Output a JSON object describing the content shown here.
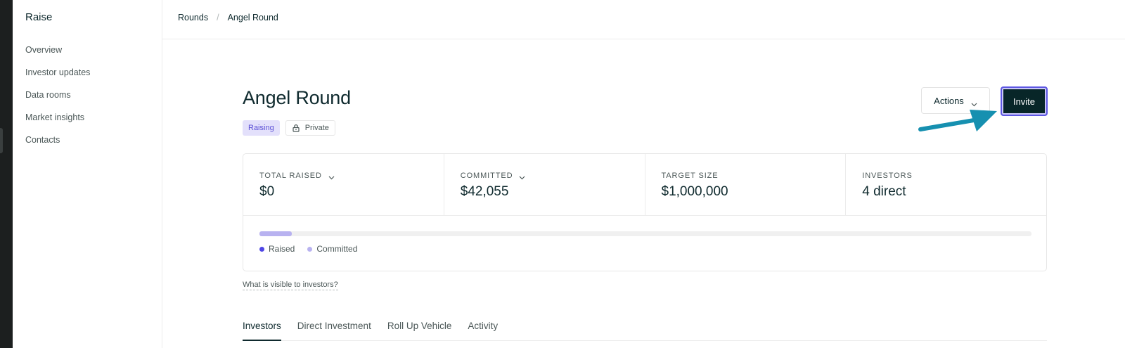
{
  "sidebar": {
    "brand": "Raise",
    "items": [
      {
        "label": "Overview"
      },
      {
        "label": "Investor updates"
      },
      {
        "label": "Data rooms"
      },
      {
        "label": "Market insights"
      },
      {
        "label": "Contacts"
      }
    ]
  },
  "breadcrumb": {
    "items": [
      "Rounds",
      "Angel Round"
    ],
    "separator": "/"
  },
  "round": {
    "title": "Angel Round",
    "status_badge": "Raising",
    "visibility_badge": "Private",
    "visibility_icon": "lock-icon"
  },
  "toolbar": {
    "actions_label": "Actions",
    "invite_label": "Invite"
  },
  "stats": [
    {
      "label": "TOTAL RAISED",
      "value": "$0",
      "has_dropdown": true
    },
    {
      "label": "COMMITTED",
      "value": "$42,055",
      "has_dropdown": true
    },
    {
      "label": "TARGET SIZE",
      "value": "$1,000,000",
      "has_dropdown": false
    },
    {
      "label": "INVESTORS",
      "value": "4 direct",
      "has_dropdown": false
    }
  ],
  "progress": {
    "raised_fraction": 0,
    "committed_fraction": 0.042,
    "legend": [
      {
        "label": "Raised",
        "color": "#4f46e5"
      },
      {
        "label": "Committed",
        "color": "#b8b2f0"
      }
    ]
  },
  "visibility_link": "What is visible to investors?",
  "tabs": [
    {
      "label": "Investors",
      "active": true
    },
    {
      "label": "Direct Investment",
      "active": false
    },
    {
      "label": "Roll Up Vehicle",
      "active": false
    },
    {
      "label": "Activity",
      "active": false
    }
  ],
  "colors": {
    "primary_button": "#082628",
    "focus_ring": "#5d57e3",
    "annotation_arrow": "#1690b0",
    "badge_raising_bg": "#e3e0fb",
    "badge_raising_text": "#5b4fd6"
  }
}
